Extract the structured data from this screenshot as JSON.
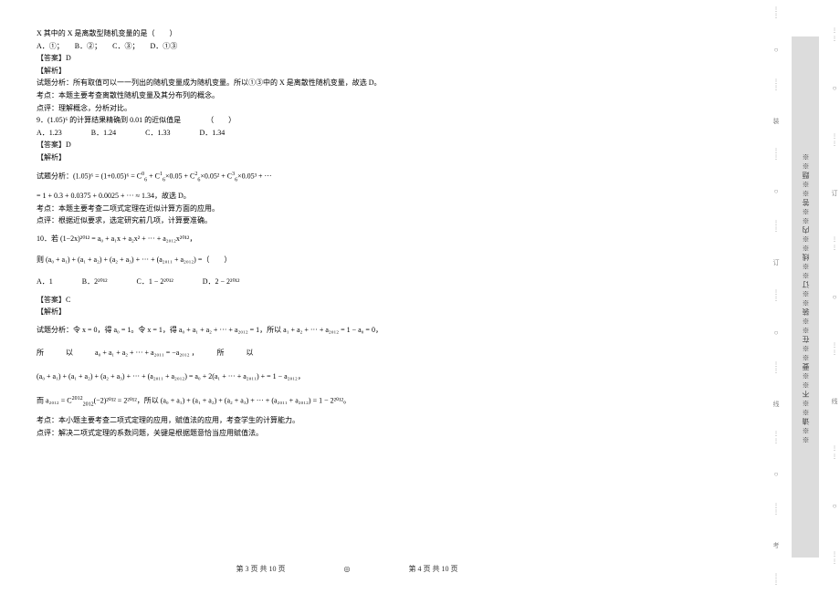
{
  "left_page": {
    "q8_line1": "X 其中的 X 是离散型随机变量的是（　　）",
    "q8_options": "A．①；　　B．②；　　C．③；　　D．①③",
    "q8_answer": "【答案】D",
    "q8_parse_label": "【解析】",
    "q8_parse1": "试题分析：所有取值可以一一列出的随机变量成为随机变量。所以①③中的 X 是离散性随机变量，故选 D。",
    "q8_kaodian": "考点：本题主要考查离散性随机变量及其分布列的概念。",
    "q8_dianping": "点评：理解概念，分析对比。",
    "q9_stem": "9．(1.05)⁶ 的计算结果精确到 0.01 的近似值是　　　　（　　）",
    "q9_options": "A．1.23　　　　B．1.24　　　　C．1.33　　　　D．1.34",
    "q9_answer": "【答案】D",
    "q9_parse_label": "【解析】",
    "q9_parse1_a": "试题分析：(1.05)⁶ = (1+0.05)⁶ = C",
    "q9_parse1_b": " + C",
    "q9_parse1_c": "×0.05 + C",
    "q9_parse1_d": "×0.05² + C",
    "q9_parse1_e": "×0.05³ + ···",
    "q9_parse2": "= 1 + 0.3 + 0.0375 + 0.0025 + ··· ≈ 1.34，故选 D。",
    "q9_kaodian": "考点：本题主要考查二项式定理在近似计算方面的应用。",
    "q9_dianping": "点评：根据近似要求，选定研究前几项，计算要准确。",
    "q10_stem": "10．若 (1−2x)²⁰¹² = a₀ + a₁x + a₂x² + ··· + a₂₀₁₂x²⁰¹²，",
    "q10_stem2": "则 (a₀ + a₁) + (a₁ + a₂) + (a₂ + a₃) + ··· + (a₂₀₁₁ + a₂₀₁₂) =（　　）",
    "q10_options": "A．1　　　　B．2²⁰¹²　　　　C．1 − 2²⁰¹²　　　　D．2 − 2²⁰¹²",
    "q10_answer": "【答案】C",
    "q10_parse_label": "【解析】",
    "q10_parse1": "试题分析：令 x = 0，得 a₀ = 1。令 x = 1，得 a₀ + a₁ + a₂ + ··· + a₂₀₁₂ = 1，所以 a₁ + a₂ + ··· + a₂₀₁₂ = 1 − a₀ = 0，",
    "q10_parse2": "所　　　以　　　a₀ + a₁ + a₂ + ··· + a₂₀₁₁ = −a₂₀₁₂ ，　　　所　　　以",
    "q10_parse3": "(a₀ + a₁) + (a₁ + a₂) + (a₂ + a₃) + ··· + (a₂₀₁₁ + a₂₀₁₂) = a₀ + 2(a₁ + ··· + a₂₀₁₁) + = 1 − a₂₀₁₂，",
    "q10_parse4_a": "而 a₂₀₁₂ = C",
    "q10_parse4_b": "(−2)²⁰¹² = 2²⁰¹²，所以 (a₀ + a₁) + (a₁ + a₂) + (a₂ + a₃) + ··· + (a₂₀₁₁ + a₂₀₁₂) = 1 − 2²⁰¹²。",
    "q10_kaodian": "考点：本小题主要考查二项式定理的应用，赋值法的应用，考查学生的计算能力。",
    "q10_dianping": "点评：解决二项式定理的系数问题，关键是根据题意恰当应用赋值法。"
  },
  "footer": {
    "left": "第 3 页  共 10 页",
    "sep": "◎",
    "right": "第 4 页  共 10 页"
  },
  "sidebar": {
    "label1": "订",
    "label2": "线",
    "label3": "装",
    "label4": "考",
    "seal": "※※请※※不※※要※※在※※装※※订※※线※※内※※答※※题※※",
    "circle": "○",
    "dots3": "⋮"
  }
}
